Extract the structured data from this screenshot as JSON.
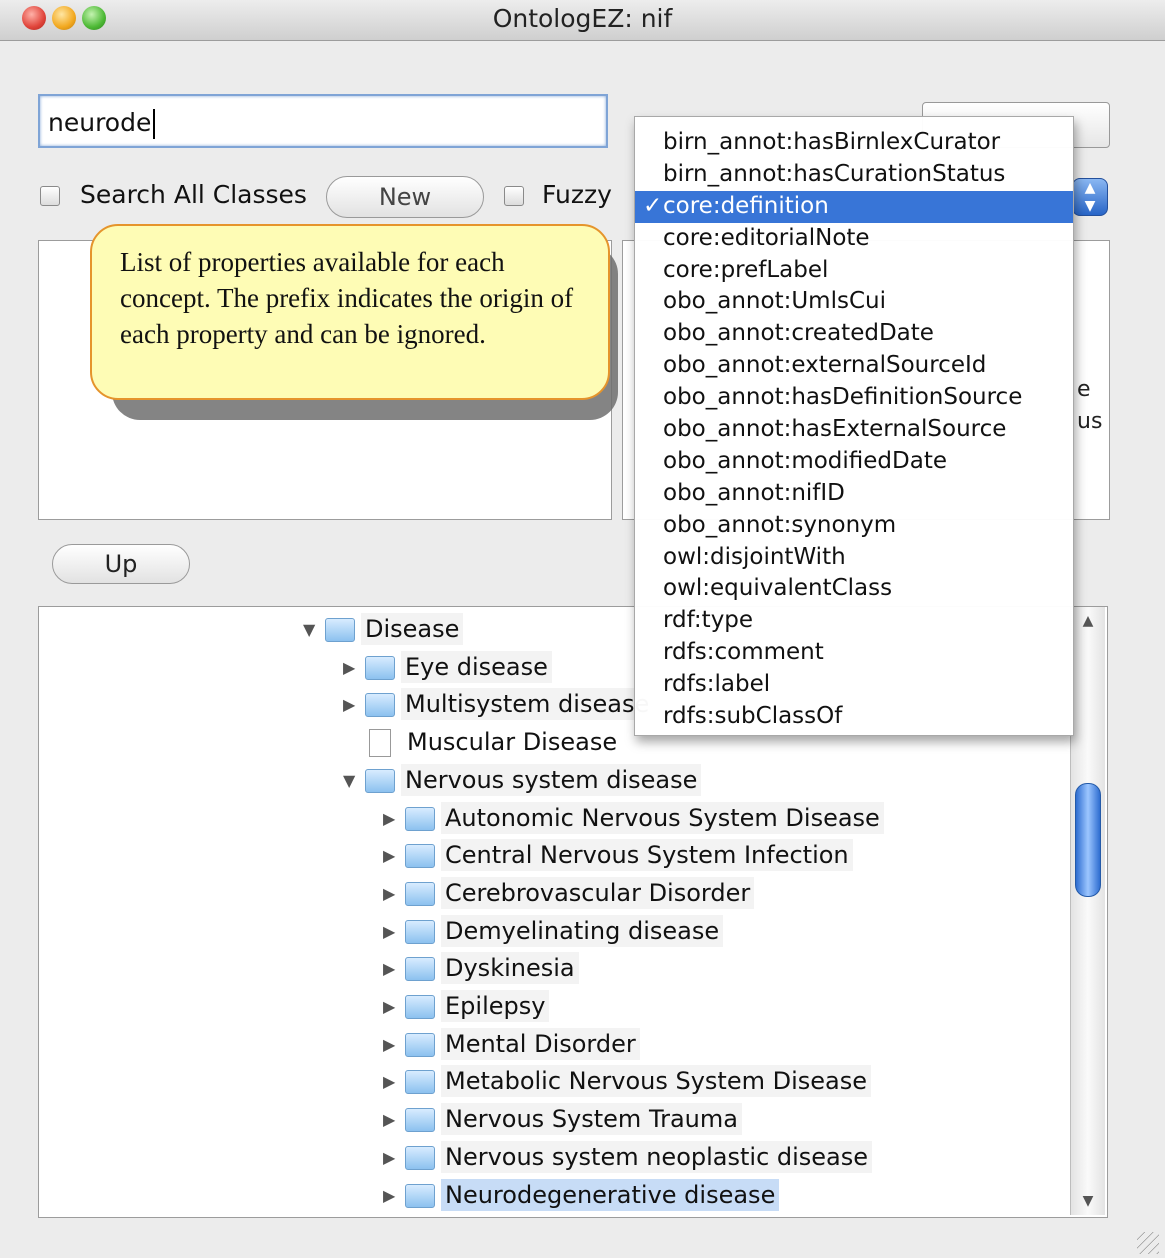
{
  "window": {
    "title": "OntologEZ: nif"
  },
  "search": {
    "value": "neurode"
  },
  "controls": {
    "search_all_label": "Search All Classes",
    "new_label": "New",
    "fuzzy_label": "Fuzzy",
    "up_label": "Up"
  },
  "callout": {
    "text": "List of properties available for each concept.  The prefix indicates the origin of each property and can be ignored."
  },
  "right_pane_fragments": [
    "e",
    "us"
  ],
  "property_menu": {
    "selected": "core:definition",
    "items": [
      "birn_annot:hasBirnlexCurator",
      "birn_annot:hasCurationStatus",
      "core:definition",
      "core:editorialNote",
      "core:prefLabel",
      "obo_annot:UmlsCui",
      "obo_annot:createdDate",
      "obo_annot:externalSourceId",
      "obo_annot:hasDefinitionSource",
      "obo_annot:hasExternalSource",
      "obo_annot:modifiedDate",
      "obo_annot:nifID",
      "obo_annot:synonym",
      "owl:disjointWith",
      "owl:equivalentClass",
      "rdf:type",
      "rdfs:comment",
      "rdfs:label",
      "rdfs:subClassOf"
    ]
  },
  "tree": {
    "items": [
      {
        "label": "Disease",
        "state": "expanded",
        "kind": "folder"
      },
      {
        "label": "Eye disease",
        "state": "collapsed",
        "kind": "folder"
      },
      {
        "label": "Multisystem disease",
        "state": "collapsed",
        "kind": "folder"
      },
      {
        "label": "Muscular Disease",
        "state": "leaf",
        "kind": "document"
      },
      {
        "label": "Nervous system disease",
        "state": "expanded",
        "kind": "folder"
      },
      {
        "label": "Autonomic Nervous System Disease",
        "state": "collapsed",
        "kind": "folder"
      },
      {
        "label": "Central Nervous System Infection",
        "state": "collapsed",
        "kind": "folder"
      },
      {
        "label": "Cerebrovascular Disorder",
        "state": "collapsed",
        "kind": "folder"
      },
      {
        "label": "Demyelinating disease",
        "state": "collapsed",
        "kind": "folder"
      },
      {
        "label": "Dyskinesia",
        "state": "collapsed",
        "kind": "folder"
      },
      {
        "label": "Epilepsy",
        "state": "collapsed",
        "kind": "folder"
      },
      {
        "label": "Mental Disorder",
        "state": "collapsed",
        "kind": "folder"
      },
      {
        "label": "Metabolic Nervous System Disease",
        "state": "collapsed",
        "kind": "folder"
      },
      {
        "label": "Nervous System Trauma",
        "state": "collapsed",
        "kind": "folder"
      },
      {
        "label": "Nervous system neoplastic disease",
        "state": "collapsed",
        "kind": "folder"
      },
      {
        "label": "Neurodegenerative disease",
        "state": "collapsed",
        "kind": "folder",
        "selected": true
      }
    ]
  },
  "colors": {
    "menu_highlight": "#3875d7",
    "callout_fill": "#fefcb5",
    "callout_border": "#e5942c",
    "tree_selection": "#c7dcf6"
  }
}
